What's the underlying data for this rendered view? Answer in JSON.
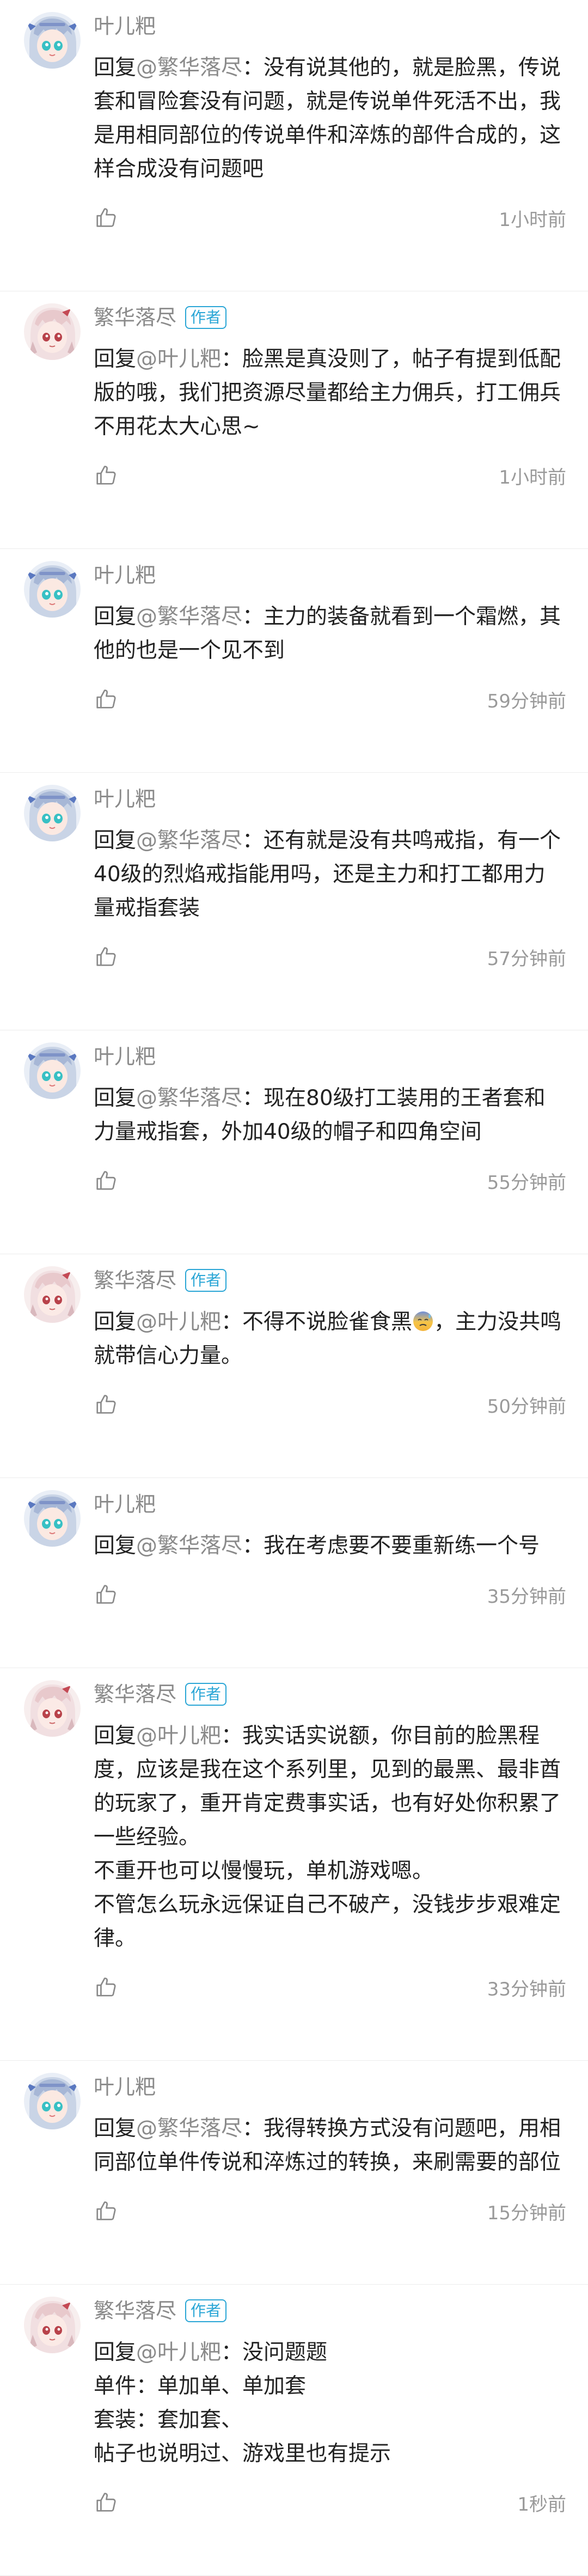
{
  "comments": [
    {
      "user": "叶儿粑",
      "is_author": false,
      "reply_prefix": "回复",
      "mention": "@繁华落尽",
      "colon": "：",
      "text": "没有说其他的，就是脸黑，传说套和冒险套没有问题，就是传说单件死活不出，我是用相同部位的传说单件和淬炼的部件合成的，这样合成没有问题吧",
      "time": "1小时前"
    },
    {
      "user": "繁华落尽",
      "is_author": true,
      "author_badge": "作者",
      "reply_prefix": "回复",
      "mention": "@叶儿粑",
      "colon": "：",
      "text": "脸黑是真没则了，帖子有提到低配版的哦，我们把资源尽量都给主力佣兵，打工佣兵不用花太大心思~",
      "time": "1小时前"
    },
    {
      "user": "叶儿粑",
      "is_author": false,
      "reply_prefix": "回复",
      "mention": "@繁华落尽",
      "colon": "：",
      "text": "主力的装备就看到一个霜燃，其他的也是一个见不到",
      "time": "59分钟前"
    },
    {
      "user": "叶儿粑",
      "is_author": false,
      "reply_prefix": "回复",
      "mention": "@繁华落尽",
      "colon": "：",
      "text": "还有就是没有共鸣戒指，有一个40级的烈焰戒指能用吗，还是主力和打工都用力量戒指套装",
      "time": "57分钟前"
    },
    {
      "user": "叶儿粑",
      "is_author": false,
      "reply_prefix": "回复",
      "mention": "@繁华落尽",
      "colon": "：",
      "text": "现在80级打工装用的王者套和力量戒指套，外加40级的帽子和四角空间",
      "time": "55分钟前"
    },
    {
      "user": "繁华落尽",
      "is_author": true,
      "author_badge": "作者",
      "reply_prefix": "回复",
      "mention": "@叶儿粑",
      "colon": "：",
      "text_before_emoji": "不得不说脸雀食黑",
      "emoji_name": "sweat-emoji",
      "text": "，主力没共鸣就带信心力量。",
      "time": "50分钟前"
    },
    {
      "user": "叶儿粑",
      "is_author": false,
      "reply_prefix": "回复",
      "mention": "@繁华落尽",
      "colon": "：",
      "text": "我在考虑要不要重新练一个号",
      "time": "35分钟前"
    },
    {
      "user": "繁华落尽",
      "is_author": true,
      "author_badge": "作者",
      "reply_prefix": "回复",
      "mention": "@叶儿粑",
      "colon": "：",
      "text": "我实话实说额，你目前的脸黑程度，应该是我在这个系列里，见到的最黑、最非酋的玩家了，重开肯定费事实话，也有好处你积累了一些经验。\n不重开也可以慢慢玩，单机游戏嗯。\n不管怎么玩永远保证自己不破产，没钱步步艰难定律。",
      "time": "33分钟前"
    },
    {
      "user": "叶儿粑",
      "is_author": false,
      "reply_prefix": "回复",
      "mention": "@繁华落尽",
      "colon": "：",
      "text": "我得转换方式没有问题吧，用相同部位单件传说和淬炼过的转换，来刷需要的部位",
      "time": "15分钟前"
    },
    {
      "user": "繁华落尽",
      "is_author": true,
      "author_badge": "作者",
      "reply_prefix": "回复",
      "mention": "@叶儿粑",
      "colon": "：",
      "text": "没问题题\n单件：单加单、单加套\n套装：套加套、\n帖子也说明过、游戏里也有提示",
      "time": "1秒前"
    }
  ],
  "icons": {
    "like": "thumbs-up-icon",
    "avatar_a": "anime-girl-blue-avatar",
    "avatar_b": "anime-girl-red-avatar"
  },
  "colors": {
    "author_badge": "#2aa6d6",
    "name": "#8a8a8a",
    "mention": "#8a8a8a",
    "time": "#9a9a9a"
  }
}
